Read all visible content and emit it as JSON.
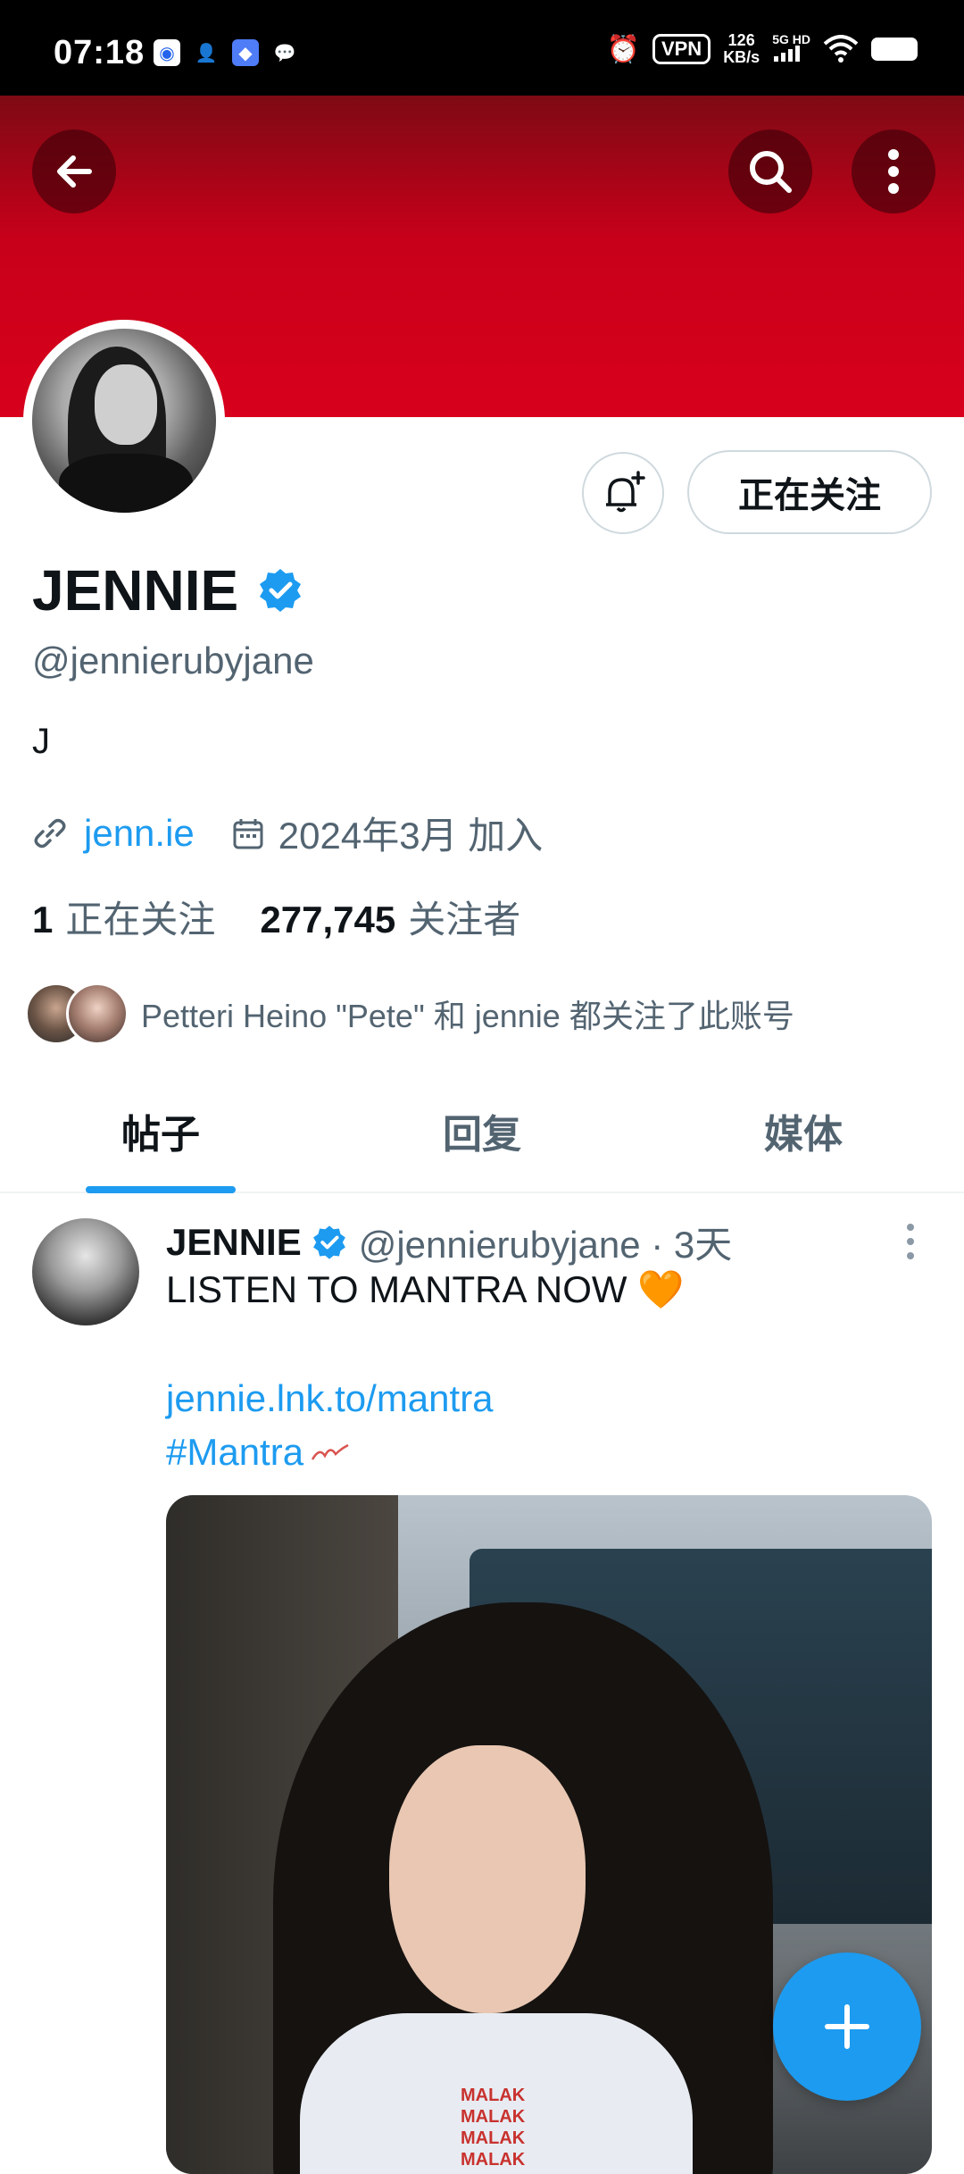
{
  "status_bar": {
    "time": "07:18",
    "vpn": "VPN",
    "speed_value": "126",
    "speed_unit": "KB/s",
    "network": "5G HD"
  },
  "profile": {
    "display_name": "JENNIE",
    "handle": "@jennierubyjane",
    "bio": "J",
    "website": "jenn.ie",
    "joined": "2024年3月 加入",
    "following_count": "1",
    "following_label": "正在关注",
    "followers_count": "277,745",
    "followers_label": "关注者",
    "followed_by_text": "Petteri Heino \"Pete\" 和 jennie 都关注了此账号",
    "follow_state_label": "正在关注"
  },
  "tabs": [
    {
      "label": "帖子",
      "active": true
    },
    {
      "label": "回复",
      "active": false
    },
    {
      "label": "媒体",
      "active": false
    }
  ],
  "post": {
    "name": "JENNIE",
    "meta": "@jennierubyjane · 3天",
    "text": "LISTEN TO MANTRA NOW 🧡",
    "link": "jennie.lnk.to/mantra",
    "hashtag": "#Mantra",
    "shirt_print": "MALAK MALAK MALAK MALAK"
  },
  "colors": {
    "banner": "#d8001c",
    "accent": "#1d9bf0",
    "verified": "#1d9bf0"
  },
  "icons": [
    "back-arrow-icon",
    "search-icon",
    "more-vertical-icon",
    "bell-plus-icon",
    "verified-badge-icon",
    "link-icon",
    "calendar-icon",
    "compose-plus-icon"
  ]
}
